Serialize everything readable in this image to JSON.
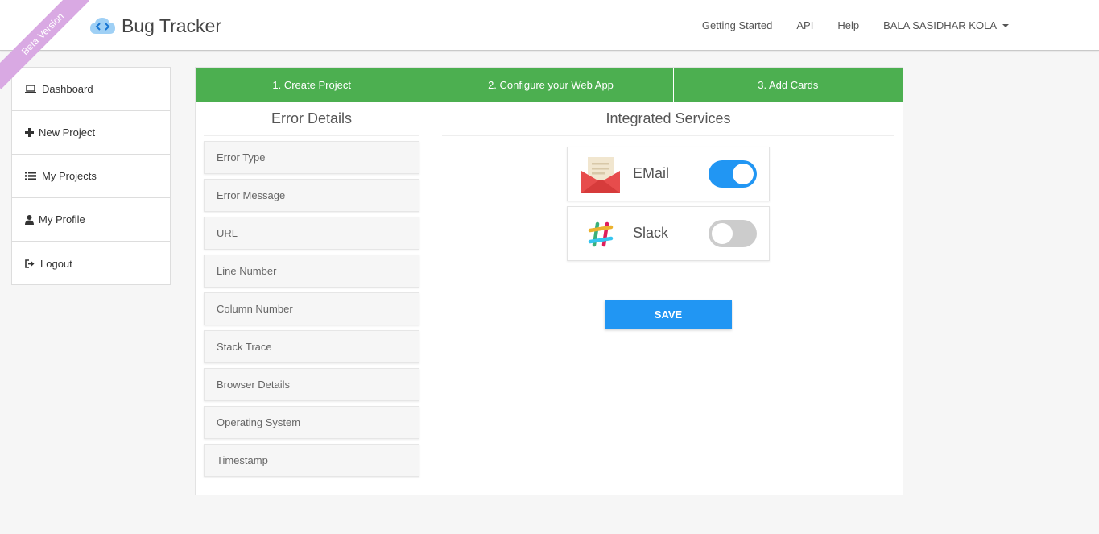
{
  "header": {
    "ribbon": "Beta Version",
    "title": "Bug Tracker",
    "logo_icon": "cloud-code-icon",
    "nav": {
      "getting_started": "Getting Started",
      "api": "API",
      "help": "Help",
      "user": "BALA SASIDHAR KOLA"
    }
  },
  "sidebar": {
    "items": [
      {
        "label": "Dashboard",
        "icon": "laptop-icon"
      },
      {
        "label": "New Project",
        "icon": "plus-icon"
      },
      {
        "label": "My Projects",
        "icon": "list-icon"
      },
      {
        "label": "My Profile",
        "icon": "user-icon"
      },
      {
        "label": "Logout",
        "icon": "logout-icon"
      }
    ]
  },
  "steps": [
    {
      "label": "1. Create Project"
    },
    {
      "label": "2. Configure your Web App"
    },
    {
      "label": "3. Add Cards"
    }
  ],
  "error_details": {
    "title": "Error Details",
    "fields": [
      "Error Type",
      "Error Message",
      "URL",
      "Line Number",
      "Column Number",
      "Stack Trace",
      "Browser Details",
      "Operating System",
      "Timestamp"
    ]
  },
  "integrated_services": {
    "title": "Integrated Services",
    "services": [
      {
        "name": "EMail",
        "icon": "email-envelope-icon",
        "enabled": true
      },
      {
        "name": "Slack",
        "icon": "slack-icon",
        "enabled": false
      }
    ],
    "save_label": "SAVE"
  },
  "colors": {
    "accent_green": "#4caf50",
    "accent_blue": "#2196f3",
    "ribbon": "#d9a9e3"
  }
}
